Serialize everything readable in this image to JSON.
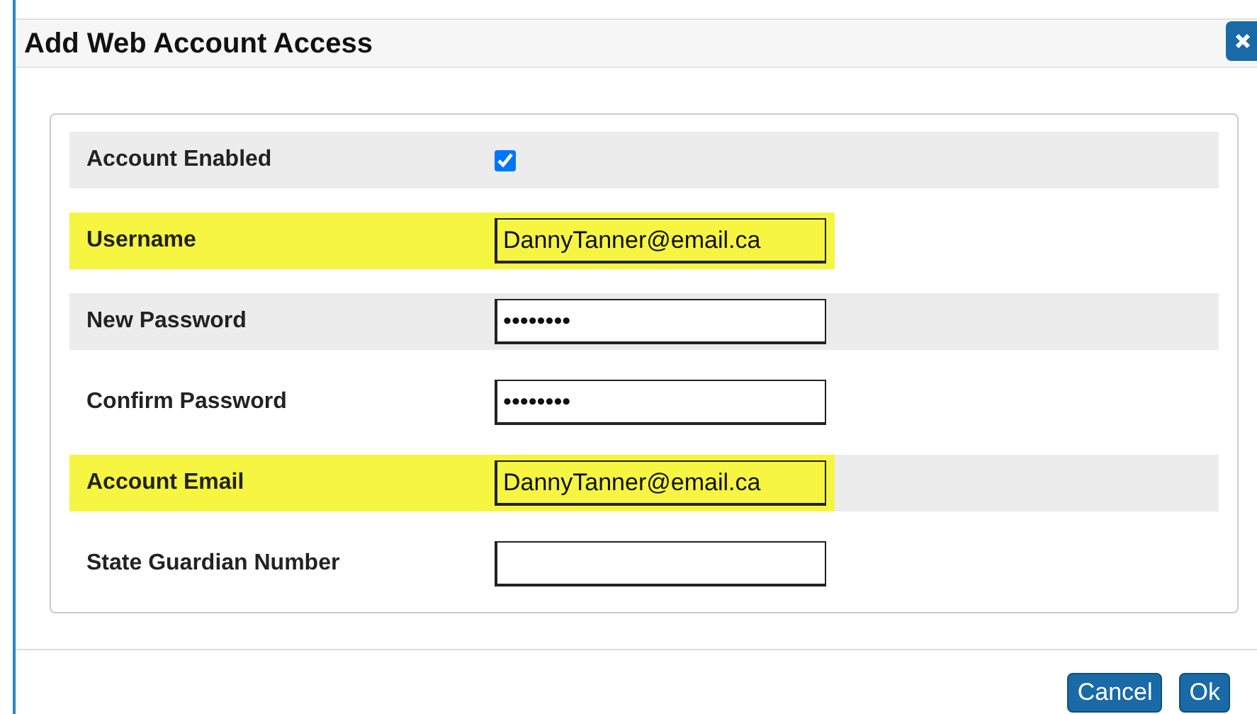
{
  "dialog": {
    "title": "Add Web Account Access"
  },
  "fields": [
    {
      "kind": "checkbox",
      "label": "Account Enabled",
      "checked": true,
      "highlighted": false
    },
    {
      "kind": "text",
      "label": "Username",
      "value": "DannyTanner@email.ca",
      "highlighted": true
    },
    {
      "kind": "text",
      "label": "New Password",
      "value": "••••••••",
      "highlighted": false
    },
    {
      "kind": "text",
      "label": "Confirm Password",
      "value": "••••••••",
      "highlighted": false
    },
    {
      "kind": "text",
      "label": "Account Email",
      "value": "DannyTanner@email.ca",
      "highlighted": true
    },
    {
      "kind": "text",
      "label": "State Guardian Number",
      "highlighted": false
    }
  ],
  "buttons": [
    "Cancel",
    "Ok"
  ]
}
